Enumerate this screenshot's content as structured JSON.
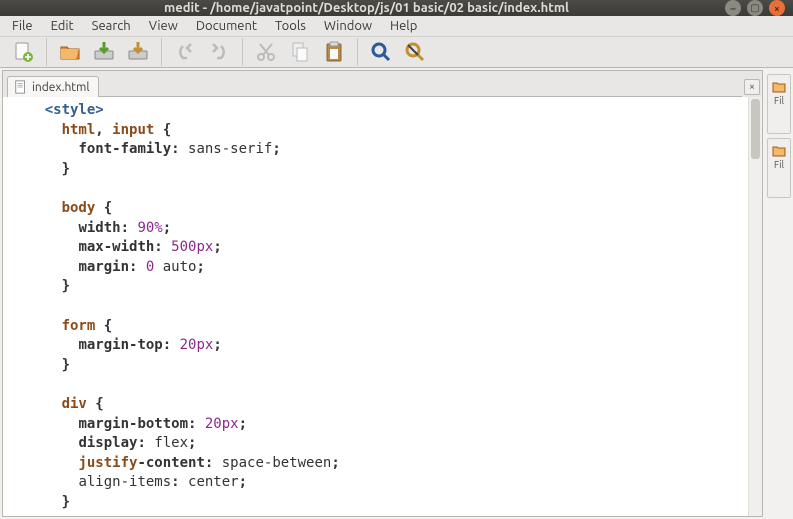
{
  "titlebar": {
    "title": "medit - /home/javatpoint/Desktop/js/01 basic/02 basic/index.html"
  },
  "menu": {
    "file": "File",
    "edit": "Edit",
    "search": "Search",
    "view": "View",
    "document": "Document",
    "tools": "Tools",
    "window": "Window",
    "help": "Help"
  },
  "tab": {
    "label": "index.html"
  },
  "side": {
    "label1": "Fil",
    "label2": "Fil"
  },
  "code": {
    "l1a": "<style>",
    "l2a": "html",
    "l2b": ", ",
    "l2c": "input",
    "l2d": " {",
    "l3a": "font-family",
    "l3b": ": ",
    "l3c": "sans-serif",
    "l3d": ";",
    "l4a": "}",
    "l5a": "body",
    "l5b": " {",
    "l6a": "width",
    "l6b": ": ",
    "l6c": "90%",
    "l6d": ";",
    "l7a": "max-width",
    "l7b": ": ",
    "l7c": "500px",
    "l7d": ";",
    "l8a": "margin",
    "l8b": ": ",
    "l8c": "0",
    "l8d": " auto",
    "l8e": ";",
    "l9a": "}",
    "l10a": "form",
    "l10b": " {",
    "l11a": "margin-top",
    "l11b": ": ",
    "l11c": "20px",
    "l11d": ";",
    "l12a": "}",
    "l13a": "div",
    "l13b": " {",
    "l14a": "margin-bottom",
    "l14b": ": ",
    "l14c": "20px",
    "l14d": ";",
    "l15a": "display",
    "l15b": ": ",
    "l15c": "flex",
    "l15d": ";",
    "l16a": "justify",
    "l16b": "-content",
    "l16c": ": ",
    "l16d": "space-between",
    "l16e": ";",
    "l17a": "align-items",
    "l17b": ": ",
    "l17c": "center",
    "l17d": ";",
    "l18a": "}"
  }
}
